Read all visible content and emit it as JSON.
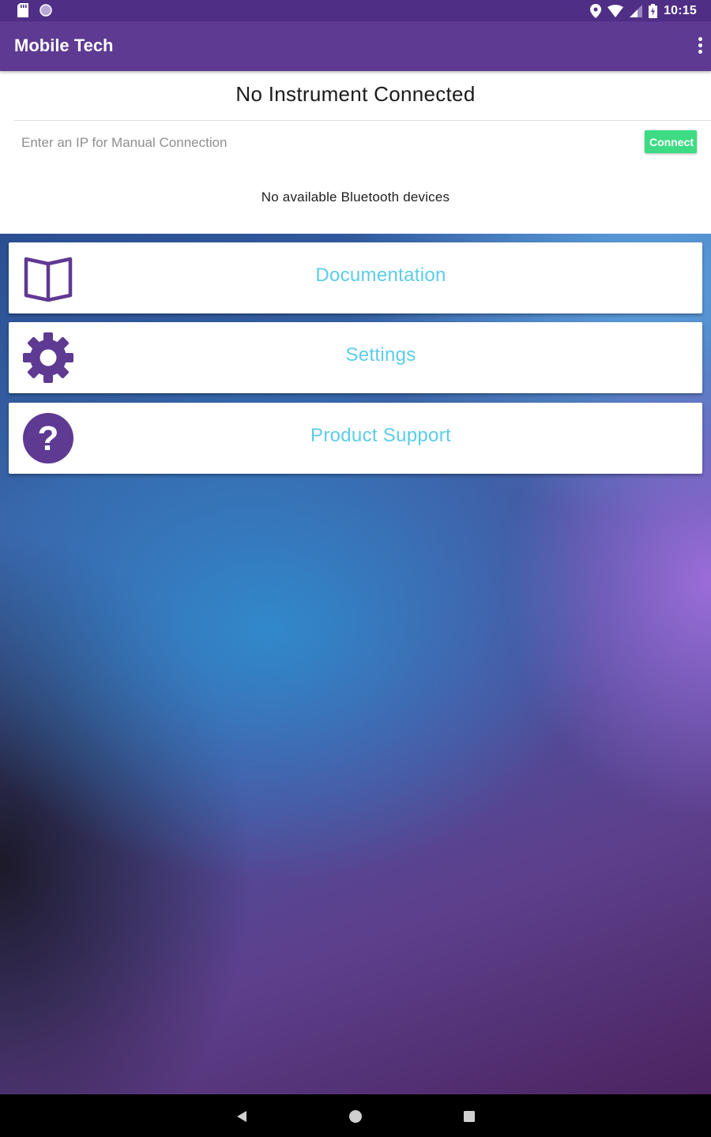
{
  "status_bar": {
    "time": "10:15",
    "icons": [
      "sd-card-icon",
      "circle-notification-icon",
      "location-icon",
      "wifi-icon",
      "signal-icon",
      "battery-charging-icon"
    ]
  },
  "app_bar": {
    "title": "Mobile Tech",
    "menu_icon": "overflow-menu-icon"
  },
  "connection": {
    "title": "No Instrument Connected",
    "ip_placeholder": "Enter an IP for Manual Connection",
    "ip_value": "",
    "connect_label": "Connect",
    "bluetooth_status": "No available Bluetooth devices"
  },
  "menu": {
    "items": [
      {
        "label": "Documentation",
        "icon": "book-icon"
      },
      {
        "label": "Settings",
        "icon": "gear-icon"
      },
      {
        "label": "Product Support",
        "icon": "help-icon"
      }
    ]
  },
  "colors": {
    "app_bar": "#5e3a93",
    "status_bar": "#4f2f86",
    "icon_purple": "#5e3a93",
    "label_cyan": "#5ccde8",
    "connect_green": "#3ddc84"
  },
  "nav_bar": {
    "buttons": [
      "back-icon",
      "home-icon",
      "recents-icon"
    ]
  }
}
